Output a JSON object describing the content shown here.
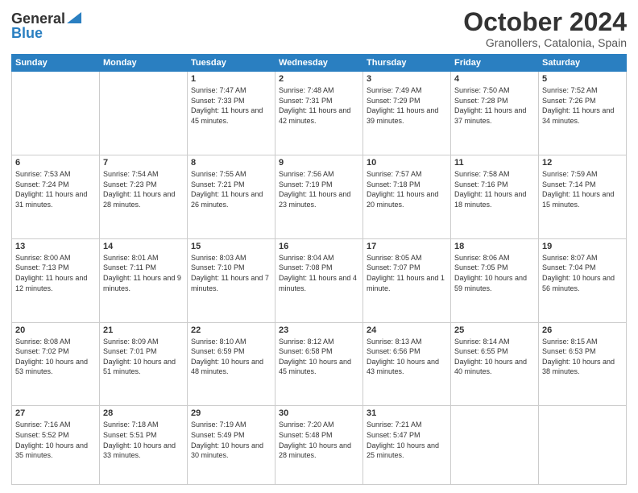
{
  "logo": {
    "general": "General",
    "blue": "Blue"
  },
  "header": {
    "month": "October 2024",
    "location": "Granollers, Catalonia, Spain"
  },
  "weekdays": [
    "Sunday",
    "Monday",
    "Tuesday",
    "Wednesday",
    "Thursday",
    "Friday",
    "Saturday"
  ],
  "weeks": [
    [
      {
        "day": "",
        "sunrise": "",
        "sunset": "",
        "daylight": ""
      },
      {
        "day": "",
        "sunrise": "",
        "sunset": "",
        "daylight": ""
      },
      {
        "day": "1",
        "sunrise": "Sunrise: 7:47 AM",
        "sunset": "Sunset: 7:33 PM",
        "daylight": "Daylight: 11 hours and 45 minutes."
      },
      {
        "day": "2",
        "sunrise": "Sunrise: 7:48 AM",
        "sunset": "Sunset: 7:31 PM",
        "daylight": "Daylight: 11 hours and 42 minutes."
      },
      {
        "day": "3",
        "sunrise": "Sunrise: 7:49 AM",
        "sunset": "Sunset: 7:29 PM",
        "daylight": "Daylight: 11 hours and 39 minutes."
      },
      {
        "day": "4",
        "sunrise": "Sunrise: 7:50 AM",
        "sunset": "Sunset: 7:28 PM",
        "daylight": "Daylight: 11 hours and 37 minutes."
      },
      {
        "day": "5",
        "sunrise": "Sunrise: 7:52 AM",
        "sunset": "Sunset: 7:26 PM",
        "daylight": "Daylight: 11 hours and 34 minutes."
      }
    ],
    [
      {
        "day": "6",
        "sunrise": "Sunrise: 7:53 AM",
        "sunset": "Sunset: 7:24 PM",
        "daylight": "Daylight: 11 hours and 31 minutes."
      },
      {
        "day": "7",
        "sunrise": "Sunrise: 7:54 AM",
        "sunset": "Sunset: 7:23 PM",
        "daylight": "Daylight: 11 hours and 28 minutes."
      },
      {
        "day": "8",
        "sunrise": "Sunrise: 7:55 AM",
        "sunset": "Sunset: 7:21 PM",
        "daylight": "Daylight: 11 hours and 26 minutes."
      },
      {
        "day": "9",
        "sunrise": "Sunrise: 7:56 AM",
        "sunset": "Sunset: 7:19 PM",
        "daylight": "Daylight: 11 hours and 23 minutes."
      },
      {
        "day": "10",
        "sunrise": "Sunrise: 7:57 AM",
        "sunset": "Sunset: 7:18 PM",
        "daylight": "Daylight: 11 hours and 20 minutes."
      },
      {
        "day": "11",
        "sunrise": "Sunrise: 7:58 AM",
        "sunset": "Sunset: 7:16 PM",
        "daylight": "Daylight: 11 hours and 18 minutes."
      },
      {
        "day": "12",
        "sunrise": "Sunrise: 7:59 AM",
        "sunset": "Sunset: 7:14 PM",
        "daylight": "Daylight: 11 hours and 15 minutes."
      }
    ],
    [
      {
        "day": "13",
        "sunrise": "Sunrise: 8:00 AM",
        "sunset": "Sunset: 7:13 PM",
        "daylight": "Daylight: 11 hours and 12 minutes."
      },
      {
        "day": "14",
        "sunrise": "Sunrise: 8:01 AM",
        "sunset": "Sunset: 7:11 PM",
        "daylight": "Daylight: 11 hours and 9 minutes."
      },
      {
        "day": "15",
        "sunrise": "Sunrise: 8:03 AM",
        "sunset": "Sunset: 7:10 PM",
        "daylight": "Daylight: 11 hours and 7 minutes."
      },
      {
        "day": "16",
        "sunrise": "Sunrise: 8:04 AM",
        "sunset": "Sunset: 7:08 PM",
        "daylight": "Daylight: 11 hours and 4 minutes."
      },
      {
        "day": "17",
        "sunrise": "Sunrise: 8:05 AM",
        "sunset": "Sunset: 7:07 PM",
        "daylight": "Daylight: 11 hours and 1 minute."
      },
      {
        "day": "18",
        "sunrise": "Sunrise: 8:06 AM",
        "sunset": "Sunset: 7:05 PM",
        "daylight": "Daylight: 10 hours and 59 minutes."
      },
      {
        "day": "19",
        "sunrise": "Sunrise: 8:07 AM",
        "sunset": "Sunset: 7:04 PM",
        "daylight": "Daylight: 10 hours and 56 minutes."
      }
    ],
    [
      {
        "day": "20",
        "sunrise": "Sunrise: 8:08 AM",
        "sunset": "Sunset: 7:02 PM",
        "daylight": "Daylight: 10 hours and 53 minutes."
      },
      {
        "day": "21",
        "sunrise": "Sunrise: 8:09 AM",
        "sunset": "Sunset: 7:01 PM",
        "daylight": "Daylight: 10 hours and 51 minutes."
      },
      {
        "day": "22",
        "sunrise": "Sunrise: 8:10 AM",
        "sunset": "Sunset: 6:59 PM",
        "daylight": "Daylight: 10 hours and 48 minutes."
      },
      {
        "day": "23",
        "sunrise": "Sunrise: 8:12 AM",
        "sunset": "Sunset: 6:58 PM",
        "daylight": "Daylight: 10 hours and 45 minutes."
      },
      {
        "day": "24",
        "sunrise": "Sunrise: 8:13 AM",
        "sunset": "Sunset: 6:56 PM",
        "daylight": "Daylight: 10 hours and 43 minutes."
      },
      {
        "day": "25",
        "sunrise": "Sunrise: 8:14 AM",
        "sunset": "Sunset: 6:55 PM",
        "daylight": "Daylight: 10 hours and 40 minutes."
      },
      {
        "day": "26",
        "sunrise": "Sunrise: 8:15 AM",
        "sunset": "Sunset: 6:53 PM",
        "daylight": "Daylight: 10 hours and 38 minutes."
      }
    ],
    [
      {
        "day": "27",
        "sunrise": "Sunrise: 7:16 AM",
        "sunset": "Sunset: 5:52 PM",
        "daylight": "Daylight: 10 hours and 35 minutes."
      },
      {
        "day": "28",
        "sunrise": "Sunrise: 7:18 AM",
        "sunset": "Sunset: 5:51 PM",
        "daylight": "Daylight: 10 hours and 33 minutes."
      },
      {
        "day": "29",
        "sunrise": "Sunrise: 7:19 AM",
        "sunset": "Sunset: 5:49 PM",
        "daylight": "Daylight: 10 hours and 30 minutes."
      },
      {
        "day": "30",
        "sunrise": "Sunrise: 7:20 AM",
        "sunset": "Sunset: 5:48 PM",
        "daylight": "Daylight: 10 hours and 28 minutes."
      },
      {
        "day": "31",
        "sunrise": "Sunrise: 7:21 AM",
        "sunset": "Sunset: 5:47 PM",
        "daylight": "Daylight: 10 hours and 25 minutes."
      },
      {
        "day": "",
        "sunrise": "",
        "sunset": "",
        "daylight": ""
      },
      {
        "day": "",
        "sunrise": "",
        "sunset": "",
        "daylight": ""
      }
    ]
  ]
}
